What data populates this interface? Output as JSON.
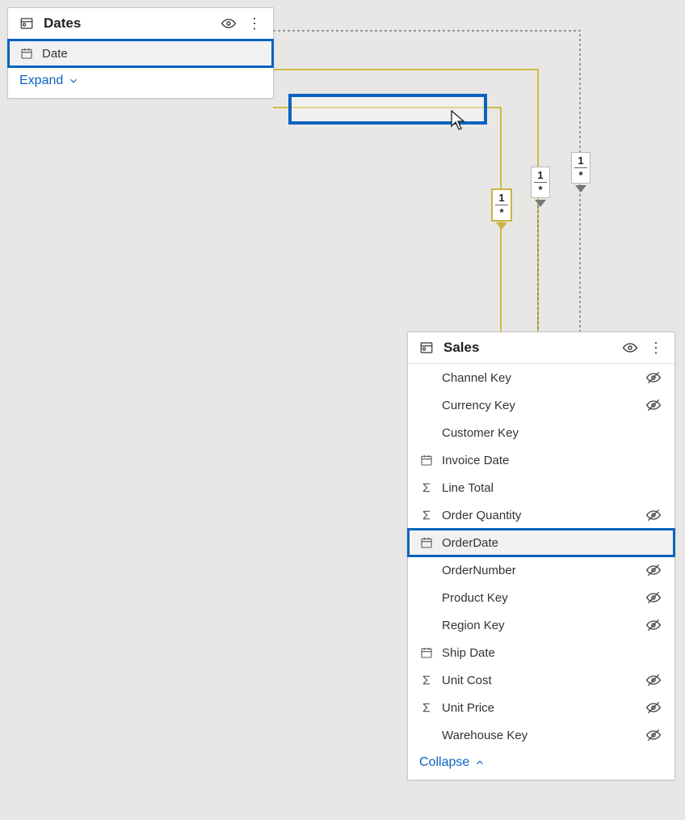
{
  "tables": {
    "dates": {
      "title": "Dates",
      "expand_label": "Expand ",
      "fields": [
        {
          "name": "Date",
          "icon": "calendar",
          "hidden": false,
          "highlighted": true
        }
      ]
    },
    "sales": {
      "title": "Sales",
      "collapse_label": "Collapse ",
      "fields": [
        {
          "name": "Channel Key",
          "icon": "",
          "hidden": true,
          "highlighted": false
        },
        {
          "name": "Currency Key",
          "icon": "",
          "hidden": true,
          "highlighted": false
        },
        {
          "name": "Customer Key",
          "icon": "",
          "hidden": false,
          "highlighted": false
        },
        {
          "name": "Invoice Date",
          "icon": "calendar",
          "hidden": false,
          "highlighted": false
        },
        {
          "name": "Line Total",
          "icon": "sum",
          "hidden": false,
          "highlighted": false
        },
        {
          "name": "Order Quantity",
          "icon": "sum",
          "hidden": true,
          "highlighted": false
        },
        {
          "name": "OrderDate",
          "icon": "calendar",
          "hidden": false,
          "highlighted": true
        },
        {
          "name": "OrderNumber",
          "icon": "",
          "hidden": true,
          "highlighted": false
        },
        {
          "name": "Product Key",
          "icon": "",
          "hidden": true,
          "highlighted": false
        },
        {
          "name": "Region Key",
          "icon": "",
          "hidden": true,
          "highlighted": false
        },
        {
          "name": "Ship Date",
          "icon": "calendar",
          "hidden": false,
          "highlighted": false
        },
        {
          "name": "Unit Cost",
          "icon": "sum",
          "hidden": true,
          "highlighted": false
        },
        {
          "name": "Unit Price",
          "icon": "sum",
          "hidden": true,
          "highlighted": false
        },
        {
          "name": "Warehouse Key",
          "icon": "",
          "hidden": true,
          "highlighted": false
        }
      ]
    }
  },
  "relationships": [
    {
      "selected": true,
      "one": "1",
      "many": "*"
    },
    {
      "selected": false,
      "one": "1",
      "many": "*"
    },
    {
      "selected": false,
      "one": "1",
      "many": "*"
    }
  ]
}
